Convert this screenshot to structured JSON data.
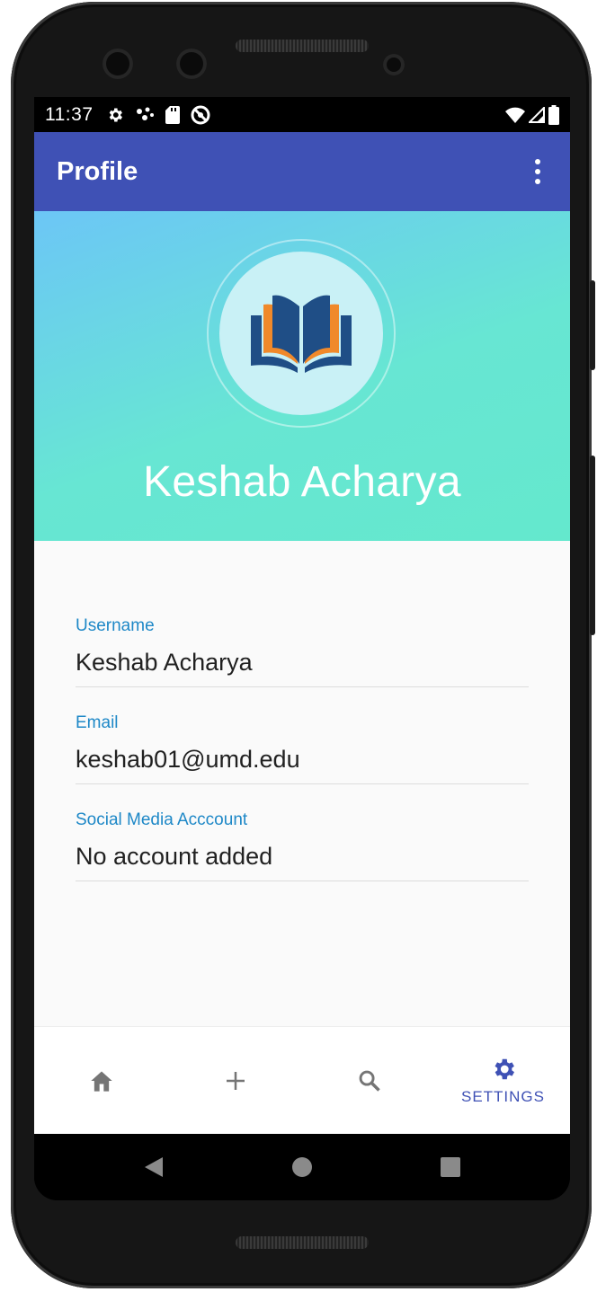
{
  "status_bar": {
    "time": "11:37",
    "left_icons": [
      "settings-icon",
      "notification-dots-icon",
      "sd-card-icon",
      "do-not-disturb-icon"
    ],
    "right_icons": [
      "wifi-icon",
      "cellular-signal-icon",
      "battery-icon"
    ]
  },
  "app_bar": {
    "title": "Profile",
    "overflow_icon": "more-vert-icon",
    "background": "#3f51b5"
  },
  "profile": {
    "name": "Keshab Acharya",
    "avatar_icon": "open-book-logo",
    "colors": {
      "book_blue": "#1f4e86",
      "book_orange": "#f0892a",
      "gradient_start": "#6cc6f6",
      "gradient_end": "#64e8cd"
    }
  },
  "fields": [
    {
      "label": "Username",
      "value": "Keshab Acharya"
    },
    {
      "label": "Email",
      "value": "keshab01@umd.edu"
    },
    {
      "label": "Social Media Acccount",
      "value": "No account added"
    }
  ],
  "bottom_nav": {
    "items": [
      {
        "icon": "home-icon",
        "label": ""
      },
      {
        "icon": "add-icon",
        "label": ""
      },
      {
        "icon": "search-icon",
        "label": ""
      },
      {
        "icon": "settings-icon",
        "label": "SETTINGS",
        "active": true
      }
    ],
    "active_color": "#3f51b5",
    "inactive_color": "#757575"
  },
  "system_nav": [
    "back-icon",
    "home-circle-icon",
    "recents-icon"
  ]
}
